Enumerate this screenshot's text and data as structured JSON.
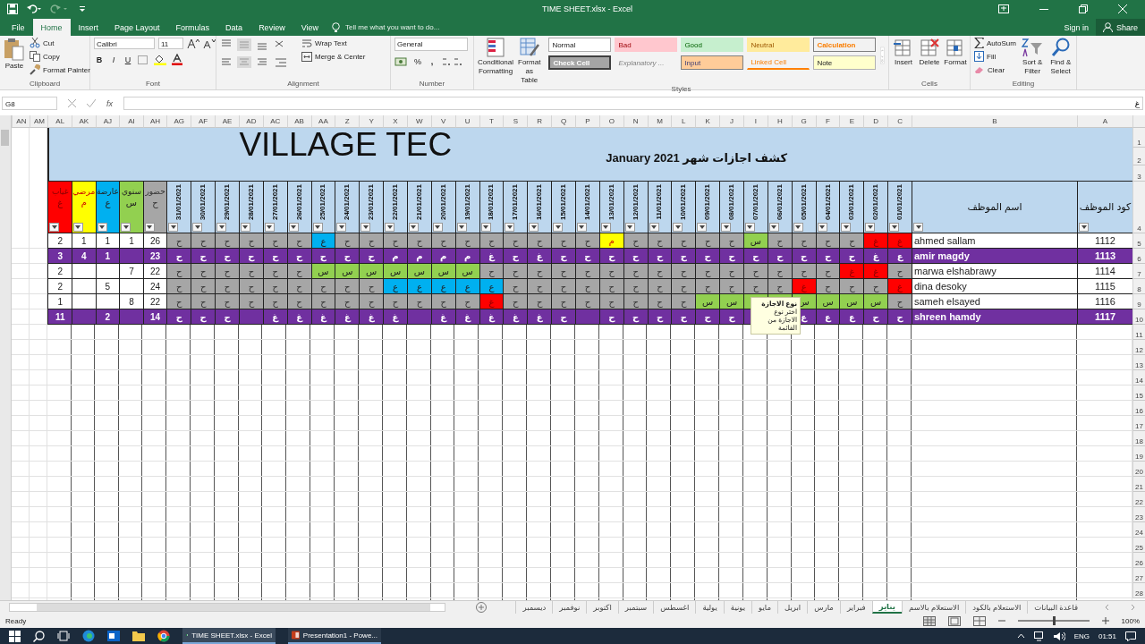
{
  "window": {
    "title": "TIME SHEET.xlsx - Excel"
  },
  "menu_tabs": [
    {
      "label": "File",
      "selected": false
    },
    {
      "label": "Home",
      "selected": true
    },
    {
      "label": "Insert",
      "selected": false
    },
    {
      "label": "Page Layout",
      "selected": false
    },
    {
      "label": "Formulas",
      "selected": false
    },
    {
      "label": "Data",
      "selected": false
    },
    {
      "label": "Review",
      "selected": false
    },
    {
      "label": "View",
      "selected": false
    }
  ],
  "tell_me": {
    "placeholder": "Tell me what you want to do..."
  },
  "account": {
    "sign_in": "Sign in",
    "share": "Share"
  },
  "ribbon": {
    "clipboard": {
      "label": "Clipboard",
      "paste": "Paste",
      "cut": "Cut",
      "copy": "Copy",
      "format_painter": "Format Painter"
    },
    "font": {
      "label": "Font",
      "family": "Calibri",
      "size": "11",
      "bold": "B",
      "italic": "I",
      "underline": "U"
    },
    "alignment": {
      "label": "Alignment",
      "wrap_text": "Wrap Text",
      "merge_center": "Merge & Center"
    },
    "number": {
      "label": "Number",
      "format": "General",
      "percent": "%",
      "comma": ","
    },
    "styles": {
      "label": "Styles",
      "conditional_formatting": "Conditional Formatting",
      "format_as_table": "Format as Table",
      "cell_styles": [
        {
          "label": "Normal",
          "kind": "normal"
        },
        {
          "label": "Bad",
          "kind": "bad"
        },
        {
          "label": "Good",
          "kind": "good"
        },
        {
          "label": "Neutral",
          "kind": "neutral"
        },
        {
          "label": "Calculation",
          "kind": "calculation"
        },
        {
          "label": "Check Cell",
          "kind": "check"
        },
        {
          "label": "Explanatory ...",
          "kind": "explanatory"
        },
        {
          "label": "Input",
          "kind": "input"
        },
        {
          "label": "Linked Cell",
          "kind": "linked"
        },
        {
          "label": "Note",
          "kind": "note"
        }
      ]
    },
    "cells": {
      "label": "Cells",
      "buttons": [
        "Insert",
        "Delete",
        "Format"
      ]
    },
    "editing": {
      "label": "Editing",
      "autosum": "AutoSum",
      "fill": "Fill",
      "clear": "Clear",
      "sort_filter": "Sort & Filter",
      "find_select": "Find & Select"
    }
  },
  "formula_bar": {
    "name_box": "G8",
    "fx": "fx",
    "value": "غ"
  },
  "sheet": {
    "column_headers": [
      "AN",
      "AM",
      "AL",
      "AK",
      "AJ",
      "AI",
      "AH",
      "AG",
      "AF",
      "AE",
      "AD",
      "AC",
      "AB",
      "AA",
      "Z",
      "Y",
      "X",
      "W",
      "V",
      "U",
      "T",
      "S",
      "R",
      "Q",
      "P",
      "O",
      "N",
      "M",
      "L",
      "K",
      "J",
      "I",
      "H",
      "G",
      "F",
      "E",
      "D",
      "C",
      "B",
      "A"
    ],
    "row_numbers": [
      "1",
      "2",
      "3",
      "4",
      "5",
      "6",
      "7",
      "8",
      "9",
      "10",
      "11",
      "12",
      "13",
      "14",
      "15",
      "16",
      "17",
      "18",
      "19",
      "20",
      "21",
      "22",
      "23",
      "24",
      "25",
      "26",
      "27",
      "28"
    ],
    "title": "VILLAGE TEC",
    "subtitle": "كشف اجازات شهر  January 2021",
    "code_heading": "كود الموظف",
    "name_heading": "اسم الموظف",
    "dates": [
      "01/01/2021",
      "02/01/2021",
      "03/01/2021",
      "04/01/2021",
      "05/01/2021",
      "06/01/2021",
      "07/01/2021",
      "08/01/2021",
      "09/01/2021",
      "10/01/2021",
      "11/01/2021",
      "12/01/2021",
      "13/01/2021",
      "14/01/2021",
      "15/01/2021",
      "16/01/2021",
      "17/01/2021",
      "18/01/2021",
      "19/01/2021",
      "20/01/2021",
      "21/01/2021",
      "22/01/2021",
      "23/01/2021",
      "24/01/2021",
      "25/01/2021",
      "26/01/2021",
      "27/01/2021",
      "28/01/2021",
      "29/01/2021",
      "30/01/2021",
      "31/01/2021"
    ],
    "summary_headings": [
      {
        "label": "حضور",
        "code": "ح",
        "kind": "present"
      },
      {
        "label": "سنوي",
        "code": "س",
        "kind": "annual"
      },
      {
        "label": "عارضة",
        "code": "ع",
        "kind": "casual"
      },
      {
        "label": "مرضي",
        "code": "م",
        "kind": "sick"
      },
      {
        "label": "غياب",
        "code": "غ",
        "kind": "absent"
      }
    ]
  },
  "employees": [
    {
      "code": "1112",
      "name": "ahmed sallam",
      "highlighted": false,
      "summary": {
        "present": "26",
        "annual": "1",
        "casual": "1",
        "sick": "1",
        "absent": "2"
      },
      "days": [
        {
          "code": "غ",
          "kind": "absent"
        },
        {
          "code": "غ",
          "kind": "absent"
        },
        {
          "code": "ح",
          "kind": "present"
        },
        {
          "code": "ح",
          "kind": "present"
        },
        {
          "code": "ح",
          "kind": "present"
        },
        {
          "code": "ح",
          "kind": "present"
        },
        {
          "code": "س",
          "kind": "annual"
        },
        {
          "code": "ح",
          "kind": "present"
        },
        {
          "code": "ح",
          "kind": "present"
        },
        {
          "code": "ح",
          "kind": "present"
        },
        {
          "code": "ح",
          "kind": "present"
        },
        {
          "code": "ح",
          "kind": "present"
        },
        {
          "code": "م",
          "kind": "sick"
        },
        {
          "code": "ح",
          "kind": "present"
        },
        {
          "code": "ح",
          "kind": "present"
        },
        {
          "code": "ح",
          "kind": "present"
        },
        {
          "code": "ح",
          "kind": "present"
        },
        {
          "code": "ح",
          "kind": "present"
        },
        {
          "code": "ح",
          "kind": "present"
        },
        {
          "code": "ح",
          "kind": "present"
        },
        {
          "code": "ح",
          "kind": "present"
        },
        {
          "code": "ح",
          "kind": "present"
        },
        {
          "code": "ح",
          "kind": "present"
        },
        {
          "code": "ح",
          "kind": "present"
        },
        {
          "code": "ع",
          "kind": "casual"
        },
        {
          "code": "ح",
          "kind": "present"
        },
        {
          "code": "ح",
          "kind": "present"
        },
        {
          "code": "ح",
          "kind": "present"
        },
        {
          "code": "ح",
          "kind": "present"
        },
        {
          "code": "ح",
          "kind": "present"
        },
        {
          "code": "ح",
          "kind": "present"
        }
      ]
    },
    {
      "code": "1113",
      "name": "amir magdy",
      "highlighted": true,
      "summary": {
        "present": "23",
        "casual": "1",
        "sick": "4",
        "absent": "3"
      },
      "days": [
        {
          "code": "ع",
          "kind": "highlight"
        },
        {
          "code": "غ",
          "kind": "highlight"
        },
        {
          "code": "ح",
          "kind": "highlight"
        },
        {
          "code": "ح",
          "kind": "highlight"
        },
        {
          "code": "ح",
          "kind": "highlight"
        },
        {
          "code": "ح",
          "kind": "highlight"
        },
        {
          "code": "ح",
          "kind": "highlight"
        },
        {
          "code": "ح",
          "kind": "highlight"
        },
        {
          "code": "ح",
          "kind": "highlight"
        },
        {
          "code": "ح",
          "kind": "highlight"
        },
        {
          "code": "ح",
          "kind": "highlight"
        },
        {
          "code": "ح",
          "kind": "highlight"
        },
        {
          "code": "ح",
          "kind": "highlight"
        },
        {
          "code": "ح",
          "kind": "highlight"
        },
        {
          "code": "ح",
          "kind": "highlight"
        },
        {
          "code": "غ",
          "kind": "highlight"
        },
        {
          "code": "ح",
          "kind": "highlight"
        },
        {
          "code": "غ",
          "kind": "highlight"
        },
        {
          "code": "م",
          "kind": "highlight"
        },
        {
          "code": "م",
          "kind": "highlight"
        },
        {
          "code": "م",
          "kind": "highlight"
        },
        {
          "code": "م",
          "kind": "highlight"
        },
        {
          "code": "ح",
          "kind": "highlight"
        },
        {
          "code": "ح",
          "kind": "highlight"
        },
        {
          "code": "ح",
          "kind": "highlight"
        },
        {
          "code": "ح",
          "kind": "highlight"
        },
        {
          "code": "ح",
          "kind": "highlight"
        },
        {
          "code": "ح",
          "kind": "highlight"
        },
        {
          "code": "ح",
          "kind": "highlight"
        },
        {
          "code": "ح",
          "kind": "highlight"
        },
        {
          "code": "ح",
          "kind": "highlight"
        }
      ]
    },
    {
      "code": "1114",
      "name": "marwa elshabrawy",
      "highlighted": false,
      "summary": {
        "present": "22",
        "annual": "7",
        "absent": "2"
      },
      "days": [
        {
          "code": "ح",
          "kind": "present"
        },
        {
          "code": "غ",
          "kind": "absent"
        },
        {
          "code": "غ",
          "kind": "absent"
        },
        {
          "code": "ح",
          "kind": "present"
        },
        {
          "code": "ح",
          "kind": "present"
        },
        {
          "code": "ح",
          "kind": "present"
        },
        {
          "code": "ح",
          "kind": "present"
        },
        {
          "code": "ح",
          "kind": "present"
        },
        {
          "code": "ح",
          "kind": "present"
        },
        {
          "code": "ح",
          "kind": "present"
        },
        {
          "code": "ح",
          "kind": "present"
        },
        {
          "code": "ح",
          "kind": "present"
        },
        {
          "code": "ح",
          "kind": "present"
        },
        {
          "code": "ح",
          "kind": "present"
        },
        {
          "code": "ح",
          "kind": "present"
        },
        {
          "code": "ح",
          "kind": "present"
        },
        {
          "code": "ح",
          "kind": "present"
        },
        {
          "code": "ح",
          "kind": "present"
        },
        {
          "code": "س",
          "kind": "annual"
        },
        {
          "code": "س",
          "kind": "annual"
        },
        {
          "code": "س",
          "kind": "annual"
        },
        {
          "code": "س",
          "kind": "annual"
        },
        {
          "code": "س",
          "kind": "annual"
        },
        {
          "code": "س",
          "kind": "annual"
        },
        {
          "code": "س",
          "kind": "annual"
        },
        {
          "code": "ح",
          "kind": "present"
        },
        {
          "code": "ح",
          "kind": "present"
        },
        {
          "code": "ح",
          "kind": "present"
        },
        {
          "code": "ح",
          "kind": "present"
        },
        {
          "code": "ح",
          "kind": "present"
        },
        {
          "code": "ح",
          "kind": "present"
        }
      ]
    },
    {
      "code": "1115",
      "name": "dina desoky",
      "highlighted": false,
      "summary": {
        "present": "24",
        "casual": "5",
        "absent": "2"
      },
      "days": [
        {
          "code": "غ",
          "kind": "absent"
        },
        {
          "code": "ح",
          "kind": "present"
        },
        {
          "code": "ح",
          "kind": "present"
        },
        {
          "code": "ح",
          "kind": "present"
        },
        {
          "code": "غ",
          "kind": "absent"
        },
        {
          "code": "ح",
          "kind": "present"
        },
        {
          "code": "ح",
          "kind": "present"
        },
        {
          "code": "ح",
          "kind": "present"
        },
        {
          "code": "ح",
          "kind": "present"
        },
        {
          "code": "ح",
          "kind": "present"
        },
        {
          "code": "ح",
          "kind": "present"
        },
        {
          "code": "ح",
          "kind": "present"
        },
        {
          "code": "ح",
          "kind": "present"
        },
        {
          "code": "ح",
          "kind": "present"
        },
        {
          "code": "ح",
          "kind": "present"
        },
        {
          "code": "ح",
          "kind": "present"
        },
        {
          "code": "ح",
          "kind": "present"
        },
        {
          "code": "ع",
          "kind": "casual"
        },
        {
          "code": "ع",
          "kind": "casual"
        },
        {
          "code": "ع",
          "kind": "casual"
        },
        {
          "code": "ع",
          "kind": "casual"
        },
        {
          "code": "ع",
          "kind": "casual"
        },
        {
          "code": "ح",
          "kind": "present"
        },
        {
          "code": "ح",
          "kind": "present"
        },
        {
          "code": "ح",
          "kind": "present"
        },
        {
          "code": "ح",
          "kind": "present"
        },
        {
          "code": "ح",
          "kind": "present"
        },
        {
          "code": "ح",
          "kind": "present"
        },
        {
          "code": "ح",
          "kind": "present"
        },
        {
          "code": "ح",
          "kind": "present"
        },
        {
          "code": "ح",
          "kind": "present"
        }
      ]
    },
    {
      "code": "1116",
      "name": "sameh elsayed",
      "highlighted": false,
      "summary": {
        "present": "22",
        "annual": "8",
        "absent": "1"
      },
      "days": [
        {
          "code": "ح",
          "kind": "present"
        },
        {
          "code": "س",
          "kind": "annual"
        },
        {
          "code": "س",
          "kind": "annual"
        },
        {
          "code": "س",
          "kind": "annual"
        },
        {
          "code": "س",
          "kind": "annual"
        },
        {
          "kind": "annual"
        },
        {
          "kind": "annual"
        },
        {
          "code": "س",
          "kind": "annual"
        },
        {
          "code": "س",
          "kind": "annual"
        },
        {
          "code": "ح",
          "kind": "present"
        },
        {
          "code": "ح",
          "kind": "present"
        },
        {
          "code": "ح",
          "kind": "present"
        },
        {
          "code": "ح",
          "kind": "present"
        },
        {
          "code": "ح",
          "kind": "present"
        },
        {
          "code": "ح",
          "kind": "present"
        },
        {
          "code": "ح",
          "kind": "present"
        },
        {
          "code": "ح",
          "kind": "present"
        },
        {
          "code": "غ",
          "kind": "absent"
        },
        {
          "code": "ح",
          "kind": "present"
        },
        {
          "code": "ح",
          "kind": "present"
        },
        {
          "code": "ح",
          "kind": "present"
        },
        {
          "code": "ح",
          "kind": "present"
        },
        {
          "code": "ح",
          "kind": "present"
        },
        {
          "code": "ح",
          "kind": "present"
        },
        {
          "code": "ح",
          "kind": "present"
        },
        {
          "code": "ح",
          "kind": "present"
        },
        {
          "code": "ح",
          "kind": "present"
        },
        {
          "code": "ح",
          "kind": "present"
        },
        {
          "code": "ح",
          "kind": "present"
        },
        {
          "code": "ح",
          "kind": "present"
        },
        {
          "code": "ح",
          "kind": "present"
        }
      ]
    },
    {
      "code": "1117",
      "name": "shreen hamdy",
      "highlighted": true,
      "summary": {
        "present": "14",
        "casual": "2",
        "absent": "11"
      },
      "days": [
        {
          "code": "ح",
          "kind": "highlight"
        },
        {
          "code": "ح",
          "kind": "highlight"
        },
        {
          "code": "ع",
          "kind": "highlight"
        },
        {
          "code": "ع",
          "kind": "highlight"
        },
        {
          "code": "ع",
          "kind": "highlight"
        },
        {
          "kind": "highlight",
          "covered": true
        },
        {
          "kind": "highlight"
        },
        {
          "code": "ح",
          "kind": "highlight"
        },
        {
          "code": "ح",
          "kind": "highlight"
        },
        {
          "code": "ح",
          "kind": "highlight"
        },
        {
          "code": "ح",
          "kind": "highlight"
        },
        {
          "code": "ح",
          "kind": "highlight"
        },
        {
          "code": "ح",
          "kind": "highlight"
        },
        {
          "kind": "highlight"
        },
        {
          "code": "ح",
          "kind": "highlight"
        },
        {
          "code": "غ",
          "kind": "highlight"
        },
        {
          "code": "غ",
          "kind": "highlight"
        },
        {
          "code": "غ",
          "kind": "highlight"
        },
        {
          "code": "غ",
          "kind": "highlight"
        },
        {
          "code": "غ",
          "kind": "highlight"
        },
        {
          "kind": "highlight"
        },
        {
          "code": "غ",
          "kind": "highlight"
        },
        {
          "code": "غ",
          "kind": "highlight"
        },
        {
          "code": "غ",
          "kind": "highlight"
        },
        {
          "code": "غ",
          "kind": "highlight"
        },
        {
          "code": "غ",
          "kind": "highlight"
        },
        {
          "code": "غ",
          "kind": "highlight"
        },
        {
          "kind": "highlight"
        },
        {
          "code": "ح",
          "kind": "highlight"
        },
        {
          "code": "ح",
          "kind": "highlight"
        },
        {
          "code": "ح",
          "kind": "highlight"
        }
      ]
    }
  ],
  "tooltip": {
    "title": "نوع الاجازة",
    "text": "اختر نوع الاجازة من القائمة"
  },
  "sheet_tabs": [
    {
      "label": "قاعدة البيانات",
      "selected": false
    },
    {
      "label": "الاستعلام بالكود",
      "selected": false
    },
    {
      "label": "الاستعلام بالاسم",
      "selected": false
    },
    {
      "label": "يناير",
      "selected": true
    },
    {
      "label": "فبراير",
      "selected": false
    },
    {
      "label": "مارس",
      "selected": false
    },
    {
      "label": "ابريل",
      "selected": false
    },
    {
      "label": "مايو",
      "selected": false
    },
    {
      "label": "يونية",
      "selected": false
    },
    {
      "label": "يولية",
      "selected": false
    },
    {
      "label": "اغسطس",
      "selected": false
    },
    {
      "label": "سبتمبر",
      "selected": false
    },
    {
      "label": "اكتوبر",
      "selected": false
    },
    {
      "label": "نوفمبر",
      "selected": false
    },
    {
      "label": "ديسمبر",
      "selected": false
    }
  ],
  "status_bar": {
    "text": "Ready",
    "zoom": "100%",
    "zoom_slider": {
      "level": 0.5
    }
  },
  "taskbar": {
    "apps": [
      {
        "label": "TIME SHEET.xlsx - Excel",
        "kind": "excel"
      },
      {
        "label": "Presentation1 - Powe...",
        "kind": "powerpoint"
      }
    ],
    "language": "ENG",
    "time": "01:51"
  }
}
